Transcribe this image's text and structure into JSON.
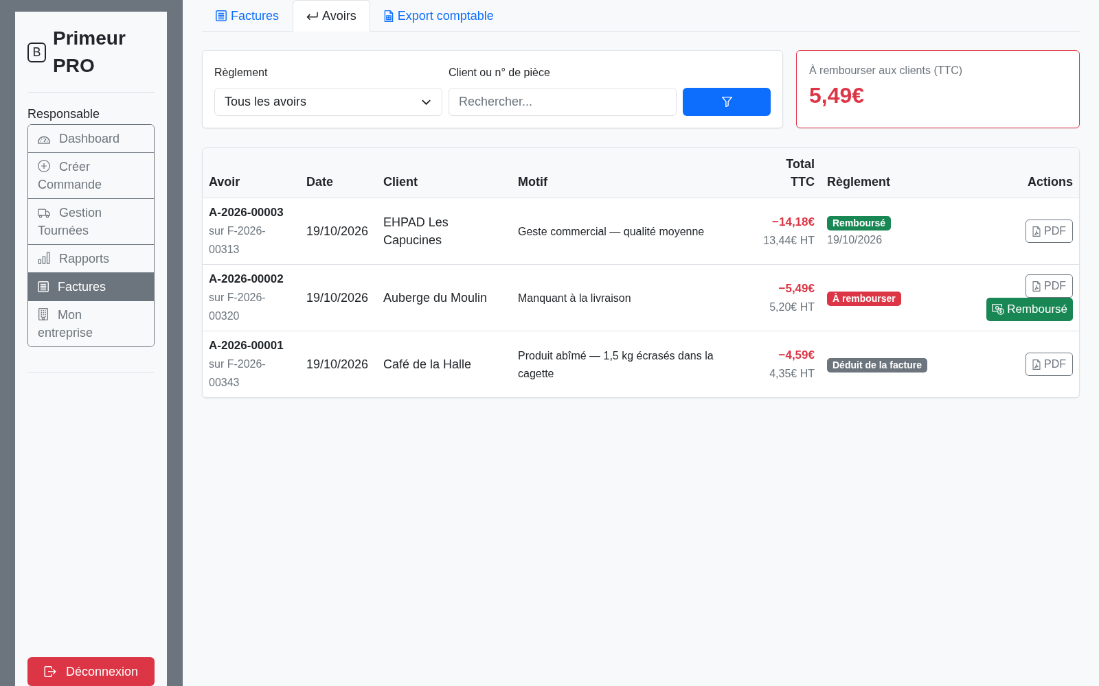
{
  "sidebar": {
    "brand": {
      "logo_letter": "B",
      "title": "Primeur PRO"
    },
    "section_label": "Responsable",
    "nav_items": [
      {
        "label": "Dashboard",
        "selected": false
      },
      {
        "label": "Créer Commande",
        "selected": false
      },
      {
        "label": "Gestion Tournées",
        "selected": false
      },
      {
        "label": "Rapports",
        "selected": false
      },
      {
        "label": "Factures",
        "selected": true
      },
      {
        "label": "Mon entreprise",
        "selected": false
      }
    ],
    "logout_button": "Déconnexion"
  },
  "main": {
    "tabs": [
      {
        "label": "Factures",
        "selected": false
      },
      {
        "label": "Avoirs",
        "selected": true
      },
      {
        "label": "Export comptable",
        "selected": false
      }
    ],
    "filters": {
      "settlement": {
        "label": "Règlement",
        "value": "Tous les avoirs"
      },
      "search": {
        "label": "Client ou n° de pièce",
        "placeholder": "Rechercher..."
      }
    },
    "summary": {
      "label": "À rembourser aux clients (TTC)",
      "value": "5,49€"
    },
    "table": {
      "columns": [
        "Avoir",
        "Date",
        "Client",
        "Motif",
        "Total TTC",
        "Règlement",
        "Actions"
      ],
      "rows": [
        {
          "credit_note": "A-2026-00003",
          "invoice_ref": "sur F-2026-00313",
          "date": "19/10/2026",
          "client": "EHPAD Les Capucines",
          "reason": "Geste commercial — qualité moyenne",
          "total_ttc": "−14,18€",
          "total_ht": "13,44€ HT",
          "settlement": {
            "kind": "refunded",
            "label": "Remboursé",
            "date": "19/10/2026"
          },
          "actions": [
            {
              "kind": "pdf",
              "label": "PDF"
            }
          ]
        },
        {
          "credit_note": "A-2026-00002",
          "invoice_ref": "sur F-2026-00320",
          "date": "19/10/2026",
          "client": "Auberge du Moulin",
          "reason": "Manquant à la livraison",
          "total_ttc": "−5,49€",
          "total_ht": "5,20€ HT",
          "settlement": {
            "kind": "pending",
            "label": "À rembourser"
          },
          "actions": [
            {
              "kind": "pdf",
              "label": "PDF"
            },
            {
              "kind": "mark_refunded",
              "label": "Remboursé"
            }
          ]
        },
        {
          "credit_note": "A-2026-00001",
          "invoice_ref": "sur F-2026-00343",
          "date": "19/10/2026",
          "client": "Café de la Halle",
          "reason": "Produit abîmé — 1,5 kg écrasés dans la cagette",
          "total_ttc": "−4,59€",
          "total_ht": "4,35€ HT",
          "settlement": {
            "kind": "deducted",
            "label": "Déduit de la facture"
          },
          "actions": [
            {
              "kind": "pdf",
              "label": "PDF"
            }
          ]
        }
      ]
    }
  }
}
